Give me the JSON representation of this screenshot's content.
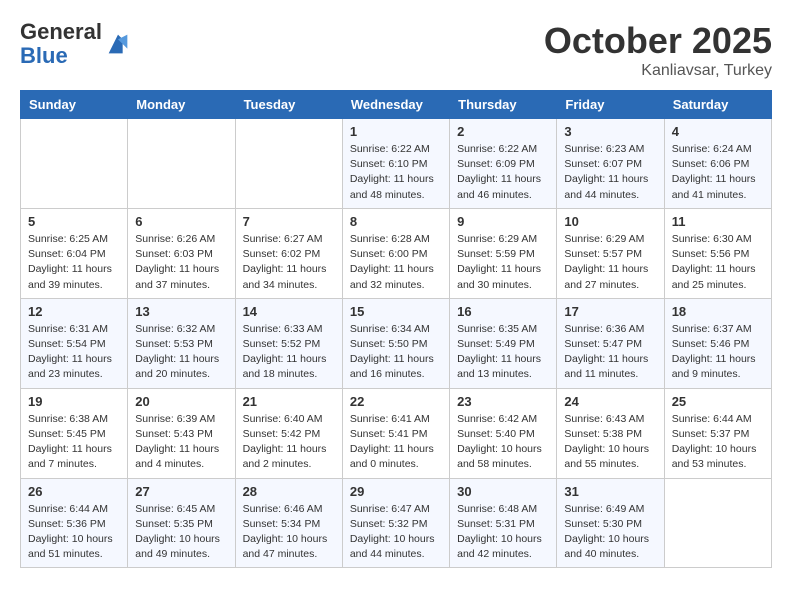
{
  "header": {
    "logo_line1": "General",
    "logo_line2": "Blue",
    "month": "October 2025",
    "location": "Kanliavsar, Turkey"
  },
  "weekdays": [
    "Sunday",
    "Monday",
    "Tuesday",
    "Wednesday",
    "Thursday",
    "Friday",
    "Saturday"
  ],
  "weeks": [
    [
      {
        "day": "",
        "info": ""
      },
      {
        "day": "",
        "info": ""
      },
      {
        "day": "",
        "info": ""
      },
      {
        "day": "1",
        "info": "Sunrise: 6:22 AM\nSunset: 6:10 PM\nDaylight: 11 hours\nand 48 minutes."
      },
      {
        "day": "2",
        "info": "Sunrise: 6:22 AM\nSunset: 6:09 PM\nDaylight: 11 hours\nand 46 minutes."
      },
      {
        "day": "3",
        "info": "Sunrise: 6:23 AM\nSunset: 6:07 PM\nDaylight: 11 hours\nand 44 minutes."
      },
      {
        "day": "4",
        "info": "Sunrise: 6:24 AM\nSunset: 6:06 PM\nDaylight: 11 hours\nand 41 minutes."
      }
    ],
    [
      {
        "day": "5",
        "info": "Sunrise: 6:25 AM\nSunset: 6:04 PM\nDaylight: 11 hours\nand 39 minutes."
      },
      {
        "day": "6",
        "info": "Sunrise: 6:26 AM\nSunset: 6:03 PM\nDaylight: 11 hours\nand 37 minutes."
      },
      {
        "day": "7",
        "info": "Sunrise: 6:27 AM\nSunset: 6:02 PM\nDaylight: 11 hours\nand 34 minutes."
      },
      {
        "day": "8",
        "info": "Sunrise: 6:28 AM\nSunset: 6:00 PM\nDaylight: 11 hours\nand 32 minutes."
      },
      {
        "day": "9",
        "info": "Sunrise: 6:29 AM\nSunset: 5:59 PM\nDaylight: 11 hours\nand 30 minutes."
      },
      {
        "day": "10",
        "info": "Sunrise: 6:29 AM\nSunset: 5:57 PM\nDaylight: 11 hours\nand 27 minutes."
      },
      {
        "day": "11",
        "info": "Sunrise: 6:30 AM\nSunset: 5:56 PM\nDaylight: 11 hours\nand 25 minutes."
      }
    ],
    [
      {
        "day": "12",
        "info": "Sunrise: 6:31 AM\nSunset: 5:54 PM\nDaylight: 11 hours\nand 23 minutes."
      },
      {
        "day": "13",
        "info": "Sunrise: 6:32 AM\nSunset: 5:53 PM\nDaylight: 11 hours\nand 20 minutes."
      },
      {
        "day": "14",
        "info": "Sunrise: 6:33 AM\nSunset: 5:52 PM\nDaylight: 11 hours\nand 18 minutes."
      },
      {
        "day": "15",
        "info": "Sunrise: 6:34 AM\nSunset: 5:50 PM\nDaylight: 11 hours\nand 16 minutes."
      },
      {
        "day": "16",
        "info": "Sunrise: 6:35 AM\nSunset: 5:49 PM\nDaylight: 11 hours\nand 13 minutes."
      },
      {
        "day": "17",
        "info": "Sunrise: 6:36 AM\nSunset: 5:47 PM\nDaylight: 11 hours\nand 11 minutes."
      },
      {
        "day": "18",
        "info": "Sunrise: 6:37 AM\nSunset: 5:46 PM\nDaylight: 11 hours\nand 9 minutes."
      }
    ],
    [
      {
        "day": "19",
        "info": "Sunrise: 6:38 AM\nSunset: 5:45 PM\nDaylight: 11 hours\nand 7 minutes."
      },
      {
        "day": "20",
        "info": "Sunrise: 6:39 AM\nSunset: 5:43 PM\nDaylight: 11 hours\nand 4 minutes."
      },
      {
        "day": "21",
        "info": "Sunrise: 6:40 AM\nSunset: 5:42 PM\nDaylight: 11 hours\nand 2 minutes."
      },
      {
        "day": "22",
        "info": "Sunrise: 6:41 AM\nSunset: 5:41 PM\nDaylight: 11 hours\nand 0 minutes."
      },
      {
        "day": "23",
        "info": "Sunrise: 6:42 AM\nSunset: 5:40 PM\nDaylight: 10 hours\nand 58 minutes."
      },
      {
        "day": "24",
        "info": "Sunrise: 6:43 AM\nSunset: 5:38 PM\nDaylight: 10 hours\nand 55 minutes."
      },
      {
        "day": "25",
        "info": "Sunrise: 6:44 AM\nSunset: 5:37 PM\nDaylight: 10 hours\nand 53 minutes."
      }
    ],
    [
      {
        "day": "26",
        "info": "Sunrise: 6:44 AM\nSunset: 5:36 PM\nDaylight: 10 hours\nand 51 minutes."
      },
      {
        "day": "27",
        "info": "Sunrise: 6:45 AM\nSunset: 5:35 PM\nDaylight: 10 hours\nand 49 minutes."
      },
      {
        "day": "28",
        "info": "Sunrise: 6:46 AM\nSunset: 5:34 PM\nDaylight: 10 hours\nand 47 minutes."
      },
      {
        "day": "29",
        "info": "Sunrise: 6:47 AM\nSunset: 5:32 PM\nDaylight: 10 hours\nand 44 minutes."
      },
      {
        "day": "30",
        "info": "Sunrise: 6:48 AM\nSunset: 5:31 PM\nDaylight: 10 hours\nand 42 minutes."
      },
      {
        "day": "31",
        "info": "Sunrise: 6:49 AM\nSunset: 5:30 PM\nDaylight: 10 hours\nand 40 minutes."
      },
      {
        "day": "",
        "info": ""
      }
    ]
  ]
}
